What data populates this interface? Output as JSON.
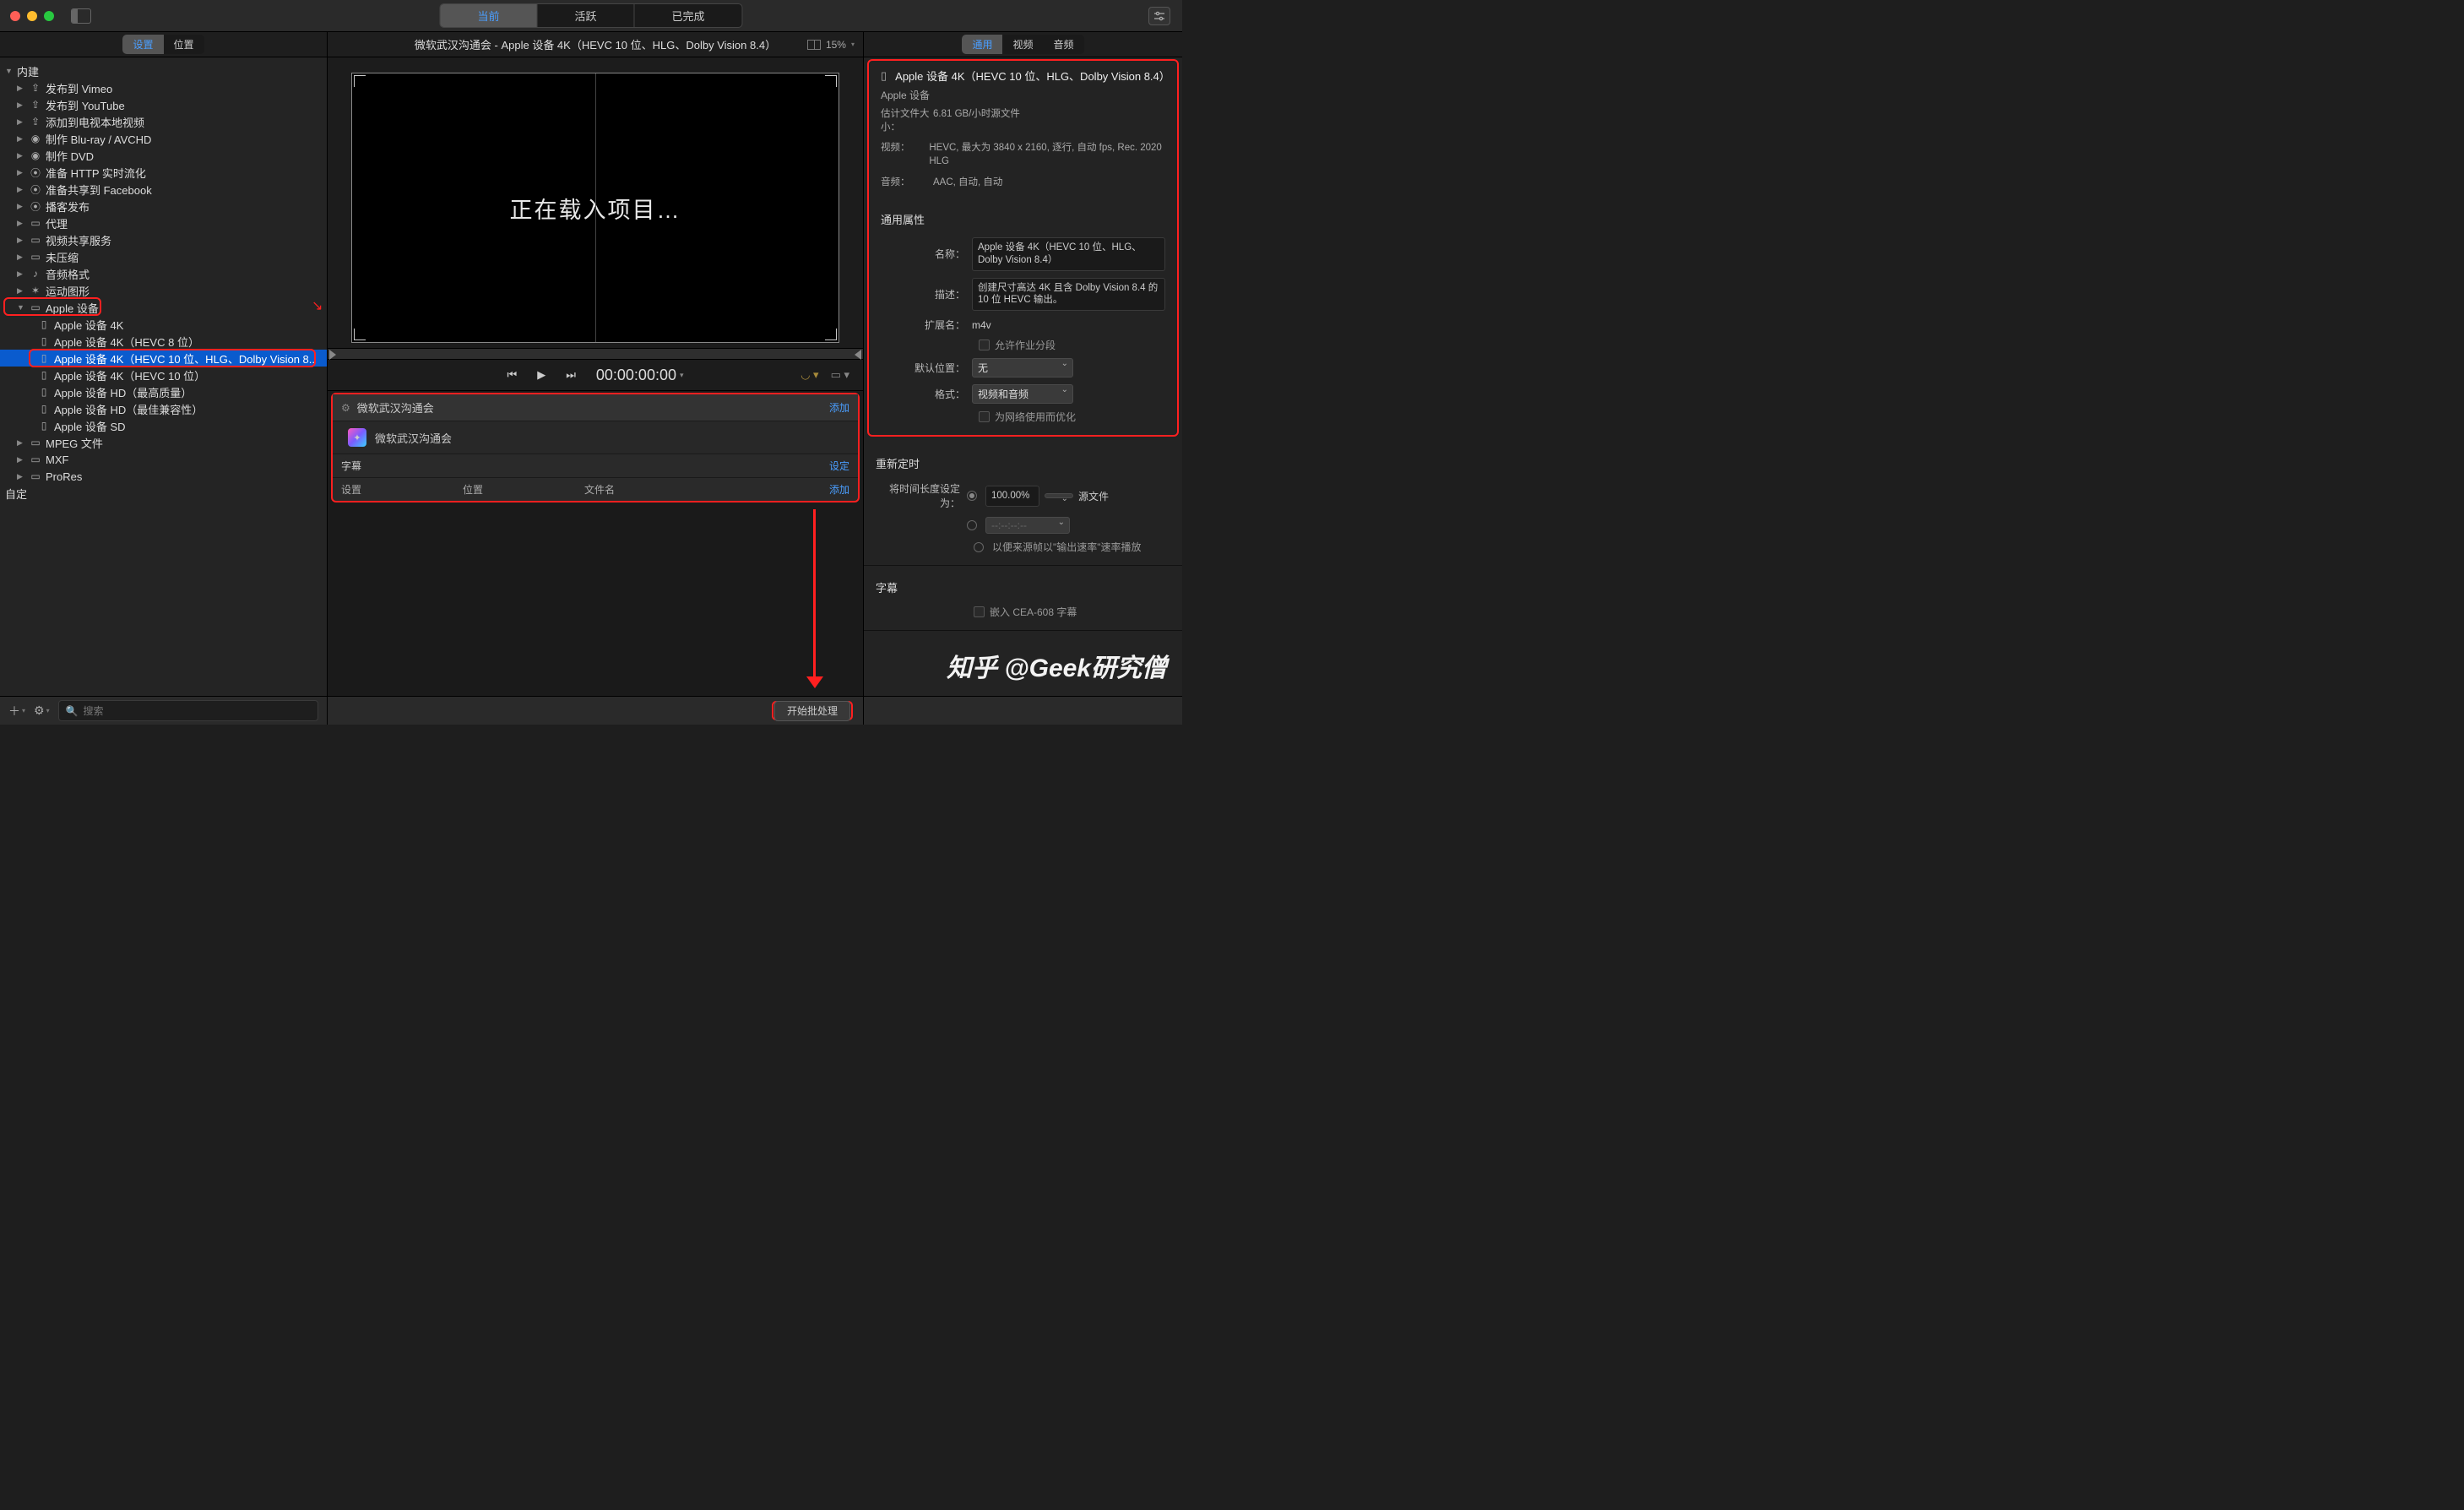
{
  "titlebar": {
    "segments": [
      "当前",
      "活跃",
      "已完成"
    ],
    "active_segment": 0
  },
  "subheader": {
    "left_tabs": [
      "设置",
      "位置"
    ],
    "left_active": 0,
    "mid_title": "微软武汉沟通会 - Apple 设备 4K（HEVC 10 位、HLG、Dolby Vision 8.4）",
    "zoom": "15%",
    "right_tabs": [
      "通用",
      "视频",
      "音频"
    ],
    "right_active": 0
  },
  "tree": {
    "root": "内建",
    "items": [
      {
        "label": "发布到 Vimeo",
        "icon": "share"
      },
      {
        "label": "发布到 YouTube",
        "icon": "share"
      },
      {
        "label": "添加到电视本地视频",
        "icon": "share"
      },
      {
        "label": "制作 Blu-ray / AVCHD",
        "icon": "disc"
      },
      {
        "label": "制作 DVD",
        "icon": "disc"
      },
      {
        "label": "准备 HTTP 实时流化",
        "icon": "globe"
      },
      {
        "label": "准备共享到 Facebook",
        "icon": "globe"
      },
      {
        "label": "播客发布",
        "icon": "globe"
      },
      {
        "label": "代理",
        "icon": "film"
      },
      {
        "label": "视频共享服务",
        "icon": "film"
      },
      {
        "label": "未压缩",
        "icon": "film"
      },
      {
        "label": "音频格式",
        "icon": "audio"
      },
      {
        "label": "运动图形",
        "icon": "motion"
      }
    ],
    "apple_group": {
      "label": "Apple 设备",
      "children": [
        "Apple 设备 4K",
        "Apple 设备 4K（HEVC 8 位）",
        "Apple 设备 4K（HEVC 10 位、HLG、Dolby Vision 8..",
        "Apple 设备 4K（HEVC 10 位）",
        "Apple 设备 HD（最高质量）",
        "Apple 设备 HD（最佳兼容性）",
        "Apple 设备 SD"
      ],
      "selected_index": 2
    },
    "bottom_items": [
      {
        "label": "MPEG 文件",
        "icon": "film"
      },
      {
        "label": "MXF",
        "icon": "film"
      },
      {
        "label": "ProRes",
        "icon": "film"
      }
    ],
    "custom_label": "自定"
  },
  "preview": {
    "loading_text": "正在载入项目…",
    "timecode": "00:00:00:00"
  },
  "batch": {
    "job_name": "微软武汉沟通会",
    "item_name": "微软武汉沟通会",
    "add_label": "添加",
    "subtitle_label": "字幕",
    "set_label": "设定",
    "cols": {
      "setting": "设置",
      "location": "位置",
      "filename": "文件名"
    }
  },
  "inspector": {
    "title": "Apple 设备 4K（HEVC 10 位、HLG、Dolby Vision 8.4）",
    "subtitle": "Apple 设备",
    "est_label": "估计文件大小：",
    "est_value": "6.81 GB/小时源文件",
    "video_label": "视频：",
    "video_value": "HEVC, 最大为 3840 x 2160, 逐行, 自动 fps, Rec. 2020 HLG",
    "audio_label": "音频：",
    "audio_value": "AAC, 自动, 自动",
    "general_props": "通用属性",
    "name_label": "名称：",
    "name_value": "Apple 设备 4K（HEVC 10 位、HLG、Dolby Vision 8.4）",
    "desc_label": "描述：",
    "desc_value": "创建尺寸高达 4K 且含 Dolby Vision 8.4 的 10 位 HEVC 输出。",
    "ext_label": "扩展名：",
    "ext_value": "m4v",
    "allow_seg_label": "允许作业分段",
    "default_loc_label": "默认位置：",
    "default_loc_value": "无",
    "format_label": "格式：",
    "format_value": "视频和音频",
    "optimize_label": "为网络使用而优化",
    "retime_title": "重新定时",
    "duration_label": "将时间长度设定为：",
    "duration_pct": "100.00%",
    "duration_src": "源文件",
    "tc_placeholder": "--:--:--:--",
    "frame_hint": "以便来源帧以\"输出速率\"速率播放",
    "subtitle_title": "字幕",
    "embed_cea": "嵌入 CEA-608 字幕"
  },
  "footer": {
    "search_placeholder": "搜索",
    "start_label": "开始批处理"
  },
  "watermark": "知乎 @Geek研究僧"
}
